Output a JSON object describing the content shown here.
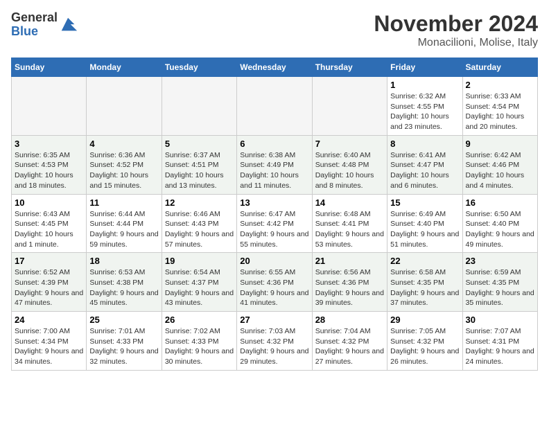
{
  "header": {
    "logo": {
      "line1": "General",
      "line2": "Blue"
    },
    "month": "November 2024",
    "location": "Monacilioni, Molise, Italy"
  },
  "weekdays": [
    "Sunday",
    "Monday",
    "Tuesday",
    "Wednesday",
    "Thursday",
    "Friday",
    "Saturday"
  ],
  "weeks": [
    [
      {
        "day": "",
        "empty": true
      },
      {
        "day": "",
        "empty": true
      },
      {
        "day": "",
        "empty": true
      },
      {
        "day": "",
        "empty": true
      },
      {
        "day": "",
        "empty": true
      },
      {
        "day": "1",
        "sunrise": "Sunrise: 6:32 AM",
        "sunset": "Sunset: 4:55 PM",
        "daylight": "Daylight: 10 hours and 23 minutes."
      },
      {
        "day": "2",
        "sunrise": "Sunrise: 6:33 AM",
        "sunset": "Sunset: 4:54 PM",
        "daylight": "Daylight: 10 hours and 20 minutes."
      }
    ],
    [
      {
        "day": "3",
        "sunrise": "Sunrise: 6:35 AM",
        "sunset": "Sunset: 4:53 PM",
        "daylight": "Daylight: 10 hours and 18 minutes."
      },
      {
        "day": "4",
        "sunrise": "Sunrise: 6:36 AM",
        "sunset": "Sunset: 4:52 PM",
        "daylight": "Daylight: 10 hours and 15 minutes."
      },
      {
        "day": "5",
        "sunrise": "Sunrise: 6:37 AM",
        "sunset": "Sunset: 4:51 PM",
        "daylight": "Daylight: 10 hours and 13 minutes."
      },
      {
        "day": "6",
        "sunrise": "Sunrise: 6:38 AM",
        "sunset": "Sunset: 4:49 PM",
        "daylight": "Daylight: 10 hours and 11 minutes."
      },
      {
        "day": "7",
        "sunrise": "Sunrise: 6:40 AM",
        "sunset": "Sunset: 4:48 PM",
        "daylight": "Daylight: 10 hours and 8 minutes."
      },
      {
        "day": "8",
        "sunrise": "Sunrise: 6:41 AM",
        "sunset": "Sunset: 4:47 PM",
        "daylight": "Daylight: 10 hours and 6 minutes."
      },
      {
        "day": "9",
        "sunrise": "Sunrise: 6:42 AM",
        "sunset": "Sunset: 4:46 PM",
        "daylight": "Daylight: 10 hours and 4 minutes."
      }
    ],
    [
      {
        "day": "10",
        "sunrise": "Sunrise: 6:43 AM",
        "sunset": "Sunset: 4:45 PM",
        "daylight": "Daylight: 10 hours and 1 minute."
      },
      {
        "day": "11",
        "sunrise": "Sunrise: 6:44 AM",
        "sunset": "Sunset: 4:44 PM",
        "daylight": "Daylight: 9 hours and 59 minutes."
      },
      {
        "day": "12",
        "sunrise": "Sunrise: 6:46 AM",
        "sunset": "Sunset: 4:43 PM",
        "daylight": "Daylight: 9 hours and 57 minutes."
      },
      {
        "day": "13",
        "sunrise": "Sunrise: 6:47 AM",
        "sunset": "Sunset: 4:42 PM",
        "daylight": "Daylight: 9 hours and 55 minutes."
      },
      {
        "day": "14",
        "sunrise": "Sunrise: 6:48 AM",
        "sunset": "Sunset: 4:41 PM",
        "daylight": "Daylight: 9 hours and 53 minutes."
      },
      {
        "day": "15",
        "sunrise": "Sunrise: 6:49 AM",
        "sunset": "Sunset: 4:40 PM",
        "daylight": "Daylight: 9 hours and 51 minutes."
      },
      {
        "day": "16",
        "sunrise": "Sunrise: 6:50 AM",
        "sunset": "Sunset: 4:40 PM",
        "daylight": "Daylight: 9 hours and 49 minutes."
      }
    ],
    [
      {
        "day": "17",
        "sunrise": "Sunrise: 6:52 AM",
        "sunset": "Sunset: 4:39 PM",
        "daylight": "Daylight: 9 hours and 47 minutes."
      },
      {
        "day": "18",
        "sunrise": "Sunrise: 6:53 AM",
        "sunset": "Sunset: 4:38 PM",
        "daylight": "Daylight: 9 hours and 45 minutes."
      },
      {
        "day": "19",
        "sunrise": "Sunrise: 6:54 AM",
        "sunset": "Sunset: 4:37 PM",
        "daylight": "Daylight: 9 hours and 43 minutes."
      },
      {
        "day": "20",
        "sunrise": "Sunrise: 6:55 AM",
        "sunset": "Sunset: 4:36 PM",
        "daylight": "Daylight: 9 hours and 41 minutes."
      },
      {
        "day": "21",
        "sunrise": "Sunrise: 6:56 AM",
        "sunset": "Sunset: 4:36 PM",
        "daylight": "Daylight: 9 hours and 39 minutes."
      },
      {
        "day": "22",
        "sunrise": "Sunrise: 6:58 AM",
        "sunset": "Sunset: 4:35 PM",
        "daylight": "Daylight: 9 hours and 37 minutes."
      },
      {
        "day": "23",
        "sunrise": "Sunrise: 6:59 AM",
        "sunset": "Sunset: 4:35 PM",
        "daylight": "Daylight: 9 hours and 35 minutes."
      }
    ],
    [
      {
        "day": "24",
        "sunrise": "Sunrise: 7:00 AM",
        "sunset": "Sunset: 4:34 PM",
        "daylight": "Daylight: 9 hours and 34 minutes."
      },
      {
        "day": "25",
        "sunrise": "Sunrise: 7:01 AM",
        "sunset": "Sunset: 4:33 PM",
        "daylight": "Daylight: 9 hours and 32 minutes."
      },
      {
        "day": "26",
        "sunrise": "Sunrise: 7:02 AM",
        "sunset": "Sunset: 4:33 PM",
        "daylight": "Daylight: 9 hours and 30 minutes."
      },
      {
        "day": "27",
        "sunrise": "Sunrise: 7:03 AM",
        "sunset": "Sunset: 4:32 PM",
        "daylight": "Daylight: 9 hours and 29 minutes."
      },
      {
        "day": "28",
        "sunrise": "Sunrise: 7:04 AM",
        "sunset": "Sunset: 4:32 PM",
        "daylight": "Daylight: 9 hours and 27 minutes."
      },
      {
        "day": "29",
        "sunrise": "Sunrise: 7:05 AM",
        "sunset": "Sunset: 4:32 PM",
        "daylight": "Daylight: 9 hours and 26 minutes."
      },
      {
        "day": "30",
        "sunrise": "Sunrise: 7:07 AM",
        "sunset": "Sunset: 4:31 PM",
        "daylight": "Daylight: 9 hours and 24 minutes."
      }
    ]
  ]
}
